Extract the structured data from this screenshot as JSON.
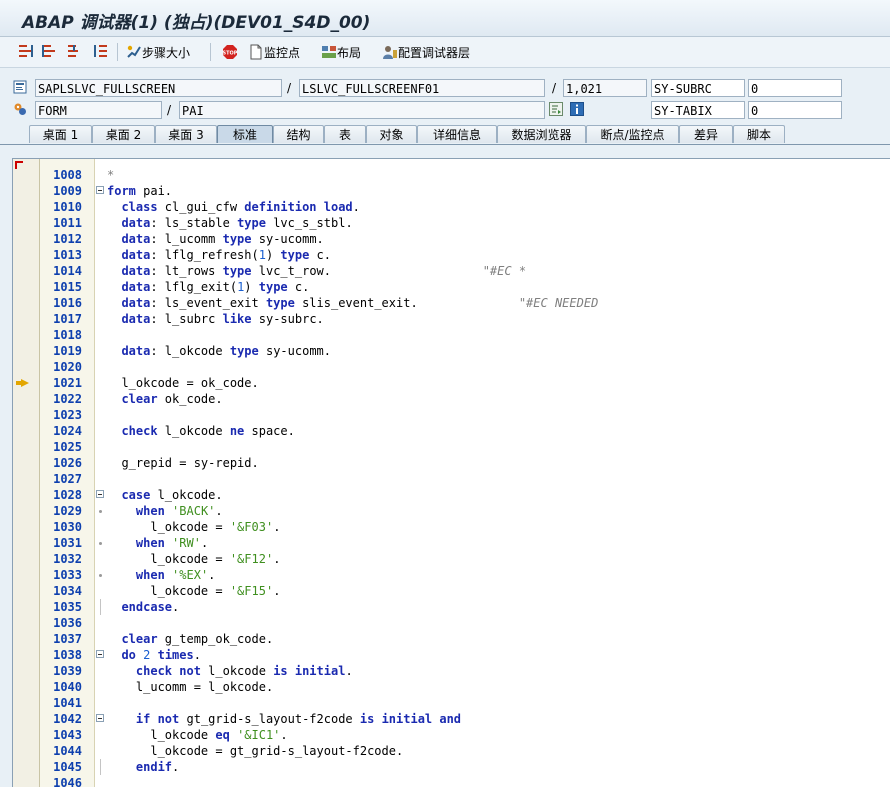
{
  "window": {
    "title": "ABAP 调试器(1) (独占)(DEV01_S4D_00)"
  },
  "toolbar": {
    "buttons": [
      {
        "label": "步骤大小",
        "icon": "step-size-icon"
      },
      {
        "label": "",
        "icon": "stop-icon"
      },
      {
        "label": "监控点",
        "icon": "watchpoint-icon"
      },
      {
        "label": "布局",
        "icon": "layout-icon"
      },
      {
        "label": "配置调试器层",
        "icon": "configure-layers-icon"
      }
    ]
  },
  "source": {
    "program": "SAPLSLVC_FULLSCREEN",
    "include": "LSLVC_FULLSCREENF01",
    "line": "1,021",
    "var1_name": "SY-SUBRC",
    "var1_value": "0",
    "event_type": "FORM",
    "event_name": "PAI",
    "var2_name": "SY-TABIX",
    "var2_value": "0"
  },
  "tabs": [
    "桌面 1",
    "桌面 2",
    "桌面 3",
    "标准",
    "结构",
    "表",
    "对象",
    "详细信息",
    "数据浏览器",
    "断点/监控点",
    "差异",
    "脚本"
  ],
  "active_tab": "标准",
  "editor": {
    "current_line": "1021",
    "lines": [
      {
        "n": "1008",
        "segs": [
          [
            "c",
            "*"
          ]
        ]
      },
      {
        "n": "1009",
        "segs": [
          [
            "k",
            "form"
          ],
          [
            "t",
            " pai."
          ]
        ]
      },
      {
        "n": "1010",
        "segs": [
          [
            "t",
            "  "
          ],
          [
            "k",
            "class"
          ],
          [
            "t",
            " cl_gui_cfw "
          ],
          [
            "k",
            "definition load"
          ],
          [
            "t",
            "."
          ]
        ]
      },
      {
        "n": "1011",
        "segs": [
          [
            "t",
            "  "
          ],
          [
            "k",
            "data"
          ],
          [
            "t",
            ": ls_stable "
          ],
          [
            "k",
            "type"
          ],
          [
            "t",
            " lvc_s_stbl."
          ]
        ]
      },
      {
        "n": "1012",
        "segs": [
          [
            "t",
            "  "
          ],
          [
            "k",
            "data"
          ],
          [
            "t",
            ": l_ucomm "
          ],
          [
            "k",
            "type"
          ],
          [
            "t",
            " sy-ucomm."
          ]
        ]
      },
      {
        "n": "1013",
        "segs": [
          [
            "t",
            "  "
          ],
          [
            "k",
            "data"
          ],
          [
            "t",
            ": lflg_refresh("
          ],
          [
            "n",
            "1"
          ],
          [
            "t",
            ") "
          ],
          [
            "k",
            "type"
          ],
          [
            "t",
            " c."
          ]
        ]
      },
      {
        "n": "1014",
        "segs": [
          [
            "t",
            "  "
          ],
          [
            "k",
            "data"
          ],
          [
            "t",
            ": lt_rows "
          ],
          [
            "k",
            "type"
          ],
          [
            "t",
            " lvc_t_row.                     "
          ],
          [
            "c",
            "\"#EC *"
          ]
        ]
      },
      {
        "n": "1015",
        "segs": [
          [
            "t",
            "  "
          ],
          [
            "k",
            "data"
          ],
          [
            "t",
            ": lflg_exit("
          ],
          [
            "n",
            "1"
          ],
          [
            "t",
            ") "
          ],
          [
            "k",
            "type"
          ],
          [
            "t",
            " c."
          ]
        ]
      },
      {
        "n": "1016",
        "segs": [
          [
            "t",
            "  "
          ],
          [
            "k",
            "data"
          ],
          [
            "t",
            ": ls_event_exit "
          ],
          [
            "k",
            "type"
          ],
          [
            "t",
            " slis_event_exit.              "
          ],
          [
            "c",
            "\"#EC NEEDED"
          ]
        ]
      },
      {
        "n": "1017",
        "segs": [
          [
            "t",
            "  "
          ],
          [
            "k",
            "data"
          ],
          [
            "t",
            ": l_subrc "
          ],
          [
            "k",
            "like"
          ],
          [
            "t",
            " sy-subrc."
          ]
        ]
      },
      {
        "n": "1018",
        "segs": []
      },
      {
        "n": "1019",
        "segs": [
          [
            "t",
            "  "
          ],
          [
            "k",
            "data"
          ],
          [
            "t",
            ": l_okcode "
          ],
          [
            "k",
            "type"
          ],
          [
            "t",
            " sy-ucomm."
          ]
        ]
      },
      {
        "n": "1020",
        "segs": []
      },
      {
        "n": "1021",
        "segs": [
          [
            "t",
            "  l_okcode = ok_code."
          ]
        ]
      },
      {
        "n": "1022",
        "segs": [
          [
            "t",
            "  "
          ],
          [
            "k",
            "clear"
          ],
          [
            "t",
            " ok_code."
          ]
        ]
      },
      {
        "n": "1023",
        "segs": []
      },
      {
        "n": "1024",
        "segs": [
          [
            "t",
            "  "
          ],
          [
            "k",
            "check"
          ],
          [
            "t",
            " l_okcode "
          ],
          [
            "k",
            "ne"
          ],
          [
            "t",
            " space."
          ]
        ]
      },
      {
        "n": "1025",
        "segs": []
      },
      {
        "n": "1026",
        "segs": [
          [
            "t",
            "  g_repid = sy-repid."
          ]
        ]
      },
      {
        "n": "1027",
        "segs": []
      },
      {
        "n": "1028",
        "segs": [
          [
            "t",
            "  "
          ],
          [
            "k",
            "case"
          ],
          [
            "t",
            " l_okcode."
          ]
        ]
      },
      {
        "n": "1029",
        "segs": [
          [
            "t",
            "    "
          ],
          [
            "k",
            "when"
          ],
          [
            "t",
            " "
          ],
          [
            "s",
            "'BACK'"
          ],
          [
            "t",
            "."
          ]
        ]
      },
      {
        "n": "1030",
        "segs": [
          [
            "t",
            "      l_okcode = "
          ],
          [
            "s",
            "'&F03'"
          ],
          [
            "t",
            "."
          ]
        ]
      },
      {
        "n": "1031",
        "segs": [
          [
            "t",
            "    "
          ],
          [
            "k",
            "when"
          ],
          [
            "t",
            " "
          ],
          [
            "s",
            "'RW'"
          ],
          [
            "t",
            "."
          ]
        ]
      },
      {
        "n": "1032",
        "segs": [
          [
            "t",
            "      l_okcode = "
          ],
          [
            "s",
            "'&F12'"
          ],
          [
            "t",
            "."
          ]
        ]
      },
      {
        "n": "1033",
        "segs": [
          [
            "t",
            "    "
          ],
          [
            "k",
            "when"
          ],
          [
            "t",
            " "
          ],
          [
            "s",
            "'%EX'"
          ],
          [
            "t",
            "."
          ]
        ]
      },
      {
        "n": "1034",
        "segs": [
          [
            "t",
            "      l_okcode = "
          ],
          [
            "s",
            "'&F15'"
          ],
          [
            "t",
            "."
          ]
        ]
      },
      {
        "n": "1035",
        "segs": [
          [
            "t",
            "  "
          ],
          [
            "k",
            "endcase"
          ],
          [
            "t",
            "."
          ]
        ]
      },
      {
        "n": "1036",
        "segs": []
      },
      {
        "n": "1037",
        "segs": [
          [
            "t",
            "  "
          ],
          [
            "k",
            "clear"
          ],
          [
            "t",
            " g_temp_ok_code."
          ]
        ]
      },
      {
        "n": "1038",
        "segs": [
          [
            "t",
            "  "
          ],
          [
            "k",
            "do"
          ],
          [
            "t",
            " "
          ],
          [
            "n",
            "2"
          ],
          [
            "t",
            " "
          ],
          [
            "k",
            "times"
          ],
          [
            "t",
            "."
          ]
        ]
      },
      {
        "n": "1039",
        "segs": [
          [
            "t",
            "    "
          ],
          [
            "k",
            "check not"
          ],
          [
            "t",
            " l_okcode "
          ],
          [
            "k",
            "is initial"
          ],
          [
            "t",
            "."
          ]
        ]
      },
      {
        "n": "1040",
        "segs": [
          [
            "t",
            "    l_ucomm = l_okcode."
          ]
        ]
      },
      {
        "n": "1041",
        "segs": []
      },
      {
        "n": "1042",
        "segs": [
          [
            "t",
            "    "
          ],
          [
            "k",
            "if not"
          ],
          [
            "t",
            " gt_grid-s_layout-f2code "
          ],
          [
            "k",
            "is initial and"
          ]
        ]
      },
      {
        "n": "1043",
        "segs": [
          [
            "t",
            "      l_okcode "
          ],
          [
            "k",
            "eq"
          ],
          [
            "t",
            " "
          ],
          [
            "s",
            "'&IC1'"
          ],
          [
            "t",
            "."
          ]
        ]
      },
      {
        "n": "1044",
        "segs": [
          [
            "t",
            "      l_okcode = gt_grid-s_layout-f2code."
          ]
        ]
      },
      {
        "n": "1045",
        "segs": [
          [
            "t",
            "    "
          ],
          [
            "k",
            "endif"
          ],
          [
            "t",
            "."
          ]
        ]
      },
      {
        "n": "1046",
        "segs": []
      }
    ]
  }
}
